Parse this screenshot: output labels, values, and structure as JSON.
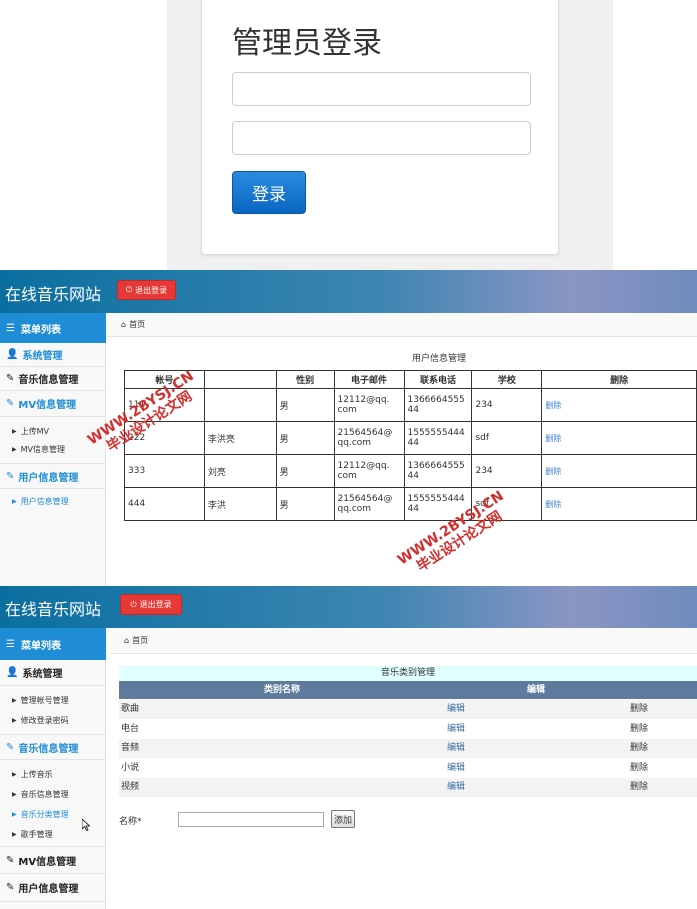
{
  "login": {
    "title": "管理员登录",
    "button_label": "登录"
  },
  "admin": {
    "site_title": "在线音乐网站",
    "logout_label": "退出登录",
    "menu_title": "菜单列表",
    "breadcrumb_home": "首页"
  },
  "user_page": {
    "sidebar": {
      "system": "系统管理",
      "music_info": "音乐信息管理",
      "mv_info": "MV信息管理",
      "upload_mv": "上传MV",
      "mv_manage": "MV信息管理",
      "user_info": "用户信息管理",
      "user_manage": "用户信息管理"
    },
    "table_title": "用户信息管理",
    "columns": [
      "帐号",
      "",
      "性别",
      "电子邮件",
      "联系电话",
      "学校",
      "删除"
    ],
    "rows": [
      {
        "account": "111",
        "name": "",
        "gender": "男",
        "email": "12112@qq.\ncom",
        "phone": "1366664555\n44",
        "school": "234",
        "delete": "删除"
      },
      {
        "account": "222",
        "name": "李洪亮",
        "gender": "男",
        "email": "21564564@\nqq.com",
        "phone": "1555555444\n44",
        "school": "sdf",
        "delete": "删除"
      },
      {
        "account": "333",
        "name": "刘亮",
        "gender": "男",
        "email": "12112@qq.\ncom",
        "phone": "1366664555\n44",
        "school": "234",
        "delete": "删除"
      },
      {
        "account": "444",
        "name": "李洪",
        "gender": "男",
        "email": "21564564@\nqq.com",
        "phone": "1555555444\n44",
        "school": "sdf",
        "delete": "删除"
      }
    ],
    "watermark_cn": "毕业设计论文网",
    "watermark_url": "WWW.2BYSJ.CN"
  },
  "category_page": {
    "sidebar": {
      "system": "系统管理",
      "account_manage": "管理帐号管理",
      "change_password": "修改登录密码",
      "music_info": "音乐信息管理",
      "upload_music": "上传音乐",
      "music_manage": "音乐信息管理",
      "category_manage": "音乐分类管理",
      "singer_manage": "歌手管理",
      "mv_info": "MV信息管理",
      "user_info": "用户信息管理"
    },
    "table_caption": "音乐类别管理",
    "columns": [
      "类别名称",
      "编辑"
    ],
    "rows": [
      {
        "name": "歌曲",
        "edit": "编辑",
        "delete": "删除"
      },
      {
        "name": "电台",
        "edit": "编辑",
        "delete": "删除"
      },
      {
        "name": "音频",
        "edit": "编辑",
        "delete": "删除"
      },
      {
        "name": "小说",
        "edit": "编辑",
        "delete": "删除"
      },
      {
        "name": "视频",
        "edit": "编辑",
        "delete": "删除"
      }
    ],
    "form": {
      "name_label": "名称*",
      "add_label": "添加"
    }
  }
}
